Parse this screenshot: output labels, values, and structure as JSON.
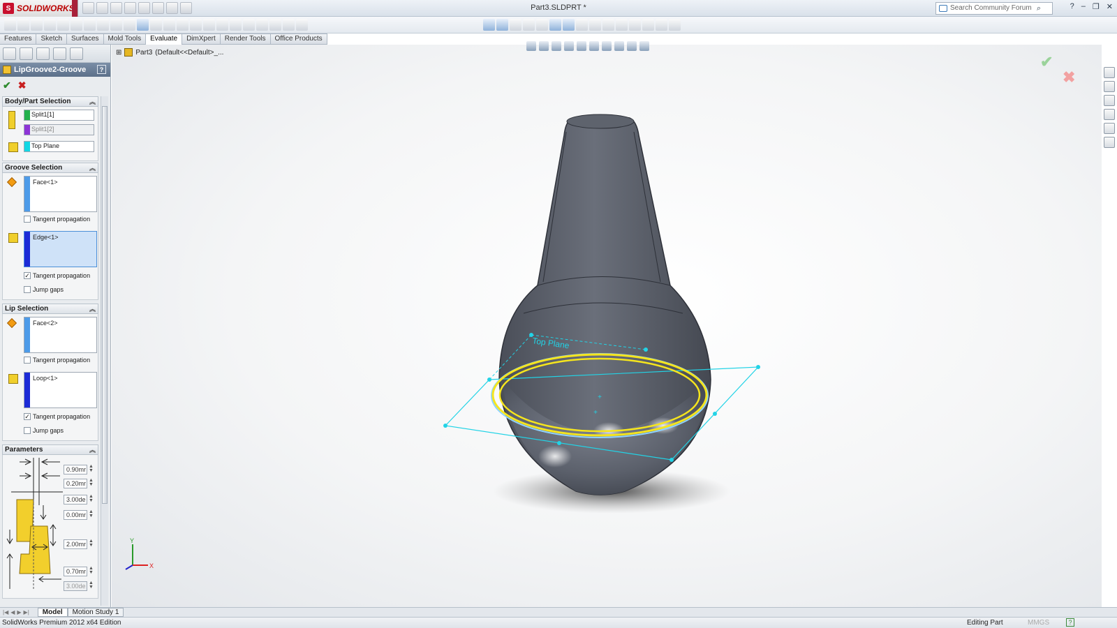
{
  "app": {
    "logo_text": "SOLIDWORKS",
    "document_title": "Part3.SLDPRT *",
    "search_placeholder": "Search Community Forum",
    "window_controls": [
      "?",
      "–",
      "❐",
      "✕"
    ]
  },
  "command_tabs": [
    {
      "label": "Features",
      "active": false
    },
    {
      "label": "Sketch",
      "active": false
    },
    {
      "label": "Surfaces",
      "active": false
    },
    {
      "label": "Mold Tools",
      "active": false
    },
    {
      "label": "Evaluate",
      "active": true
    },
    {
      "label": "DimXpert",
      "active": false
    },
    {
      "label": "Render Tools",
      "active": false
    },
    {
      "label": "Office Products",
      "active": false
    }
  ],
  "feature_panel": {
    "title": "LipGroove2-Groove",
    "help": "?",
    "ok": "✔",
    "cancel": "✖",
    "body_part_selection": {
      "header": "Body/Part Selection",
      "fields": [
        {
          "value": "Split1[1]",
          "color": "#22b14c"
        },
        {
          "value": "Split1[2]",
          "color": "#8e35d6"
        },
        {
          "value": "Top Plane",
          "color": "#12d7e4"
        }
      ]
    },
    "groove_selection": {
      "header": "Groove Selection",
      "face_value": "Face<1>",
      "face_color": "#4d9be8",
      "tangent1_label": "Tangent propagation",
      "tangent1_checked": false,
      "edge_value": "Edge<1>",
      "edge_color": "#1c2bd6",
      "tangent2_label": "Tangent propagation",
      "tangent2_checked": true,
      "jump_label": "Jump gaps",
      "jump_checked": false
    },
    "lip_selection": {
      "header": "Lip Selection",
      "face_value": "Face<2>",
      "face_color": "#4d9be8",
      "tangent1_label": "Tangent propagation",
      "tangent1_checked": false,
      "loop_value": "Loop<1>",
      "loop_color": "#1c2bd6",
      "tangent2_label": "Tangent propagation",
      "tangent2_checked": true,
      "jump_label": "Jump gaps",
      "jump_checked": false
    },
    "parameters": {
      "header": "Parameters",
      "values": [
        "0.90mr",
        "0.20mr",
        "3.00de",
        "0.00mr",
        "2.00mr",
        "0.70mr",
        "3.00de"
      ]
    }
  },
  "feature_tree": {
    "part": "Part3",
    "config": "(Default<<Default>_..."
  },
  "viewport": {
    "plane_label": "Top Plane",
    "triad_x": "X",
    "triad_y": "Y"
  },
  "bottom_tabs": [
    {
      "label": "Model",
      "active": true
    },
    {
      "label": "Motion Study 1",
      "active": false
    }
  ],
  "status": {
    "edition": "SolidWorks Premium 2012 x64 Edition",
    "mode": "Editing Part",
    "units": "MMGS",
    "help": "?"
  }
}
